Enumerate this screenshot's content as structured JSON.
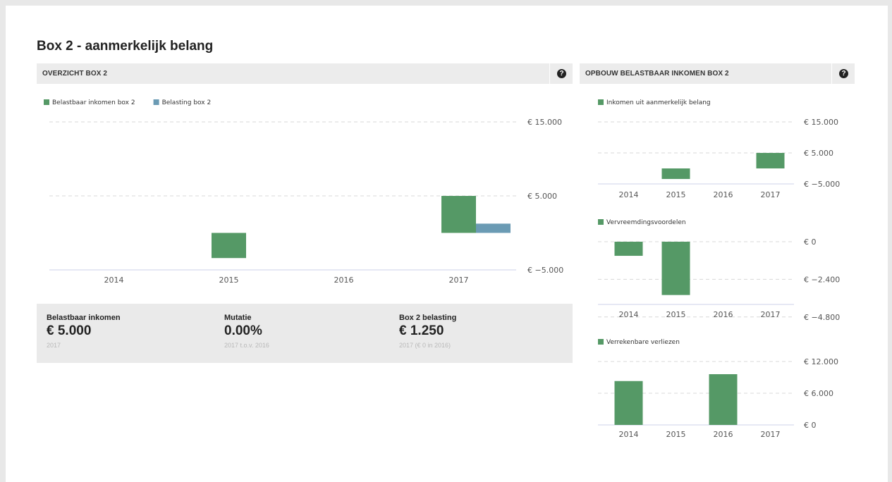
{
  "page": {
    "title": "Box 2 - aanmerkelijk belang"
  },
  "panels": {
    "overview": {
      "title": "OVERZICHT BOX 2",
      "help_icon": "question-circle-icon"
    },
    "build": {
      "title": "OPBOUW BELASTBAAR INKOMEN BOX 2",
      "help_icon": "question-circle-icon"
    }
  },
  "colors": {
    "green": "#559966",
    "blue": "#6b9bb4",
    "grid": "#d8d8d8",
    "axis": "#ccd1e8"
  },
  "chart_data": [
    {
      "id": "overview",
      "type": "bar",
      "categories": [
        "2014",
        "2015",
        "2016",
        "2017"
      ],
      "series": [
        {
          "name": "Belastbaar inkomen box 2",
          "color": "#559966",
          "values": [
            0,
            -3400,
            0,
            5000
          ]
        },
        {
          "name": "Belasting box 2",
          "color": "#6b9bb4",
          "values": [
            0,
            0,
            0,
            1250
          ]
        }
      ],
      "yticks": [
        15000,
        5000,
        -5000
      ],
      "ytick_labels": [
        "€ 15.000",
        "€ 5.000",
        "€ −5.000"
      ],
      "ylim": [
        -5000,
        15000
      ],
      "grid": true,
      "legend": "top-left"
    },
    {
      "id": "inkomen",
      "type": "bar",
      "categories": [
        "2014",
        "2015",
        "2016",
        "2017"
      ],
      "series": [
        {
          "name": "Inkomen uit aanmerkelijk belang",
          "color": "#559966",
          "values": [
            0,
            -3400,
            0,
            5000
          ]
        }
      ],
      "yticks": [
        15000,
        5000,
        -5000
      ],
      "ytick_labels": [
        "€ 15.000",
        "€ 5.000",
        "€ −5.000"
      ],
      "ylim": [
        -5000,
        15000
      ],
      "grid": true,
      "legend": "top-left"
    },
    {
      "id": "vervreemding",
      "type": "bar",
      "categories": [
        "2014",
        "2015",
        "2016",
        "2017"
      ],
      "series": [
        {
          "name": "Vervreemdingsvoordelen",
          "color": "#559966",
          "values": [
            -900,
            -3400,
            0,
            0
          ]
        }
      ],
      "yticks": [
        0,
        -2400,
        -4800
      ],
      "ytick_labels": [
        "€ 0",
        "€ −2.400",
        "€ −4.800"
      ],
      "ylim": [
        -4000,
        0
      ],
      "grid": true,
      "legend": "top-left"
    },
    {
      "id": "verliezen",
      "type": "bar",
      "categories": [
        "2014",
        "2015",
        "2016",
        "2017"
      ],
      "series": [
        {
          "name": "Verrekenbare verliezen",
          "color": "#559966",
          "values": [
            8300,
            0,
            9600,
            0
          ]
        }
      ],
      "yticks": [
        12000,
        6000,
        0
      ],
      "ytick_labels": [
        "€ 12.000",
        "€ 6.000",
        "€ 0"
      ],
      "ylim": [
        0,
        12000
      ],
      "grid": true,
      "legend": "top-left"
    }
  ],
  "stats": [
    {
      "label": "Belastbaar inkomen",
      "value": "€ 5.000",
      "sub": "2017"
    },
    {
      "label": "Mutatie",
      "value": "0.00%",
      "sub": "2017 t.o.v. 2016"
    },
    {
      "label": "Box 2 belasting",
      "value": "€ 1.250",
      "sub": "2017 (€ 0 in 2016)"
    }
  ]
}
